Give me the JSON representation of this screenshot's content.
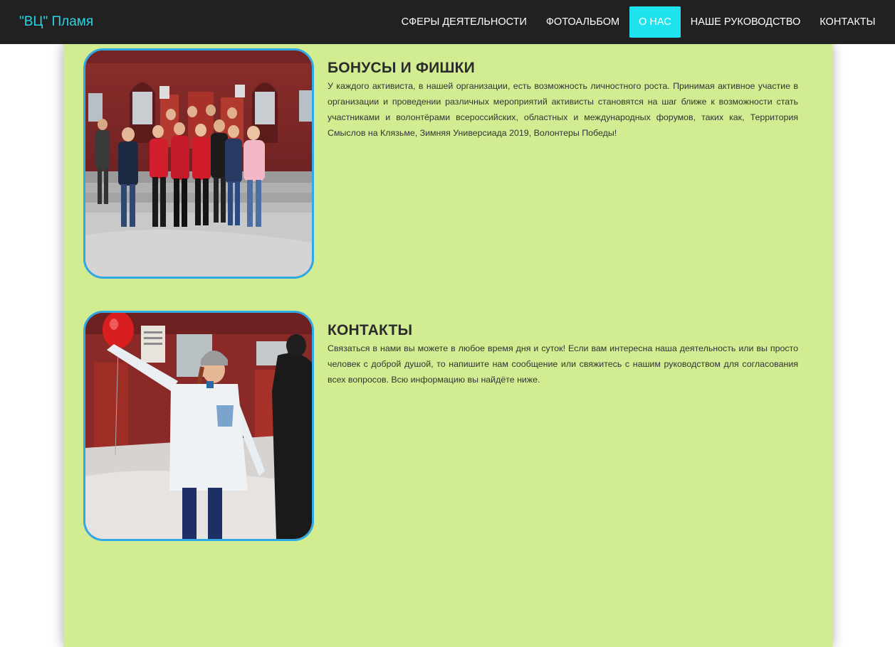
{
  "navbar": {
    "brand": "\"ВЦ\" Пламя",
    "items": [
      {
        "label": "СФЕРЫ ДЕЯТЕЛЬНОСТИ",
        "active": false
      },
      {
        "label": "ФОТОАЛЬБОМ",
        "active": false
      },
      {
        "label": "О НАС",
        "active": true
      },
      {
        "label": "НАШЕ РУКОВОДСТВО",
        "active": false
      },
      {
        "label": "КОНТАКТЫ",
        "active": false
      }
    ],
    "colors": {
      "background": "#212121",
      "brand": "#2ad4e6",
      "active": "#1ee3ef"
    }
  },
  "main": {
    "background": "#d2ec92",
    "sections": [
      {
        "title": "БОНУСЫ И ФИШКИ",
        "text": "У каждого активиста, в нашей организации, есть возможность личностного роста. Принимая активное участие в организации и проведении различных мероприятий активисты становятся на шаг ближе к возможности стать участниками и волонтёрами всероссийских, областных и международных форумов, таких как, Территория Смыслов на Клязьме, Зимняя Универсиада 2019, Волонтеры Победы!",
        "photo": "group-photo"
      },
      {
        "title": "КОНТАКТЫ",
        "text": "Связаться в нами вы можете в любое время дня и суток! Если вам интересна наша деятельность или вы просто человек с доброй душой, то напишите нам сообщение или свяжитесь с нашим руководством для согласования всех вопросов. Всю информацию вы найдёте ниже.",
        "photo": "volunteer-photo"
      }
    ]
  }
}
